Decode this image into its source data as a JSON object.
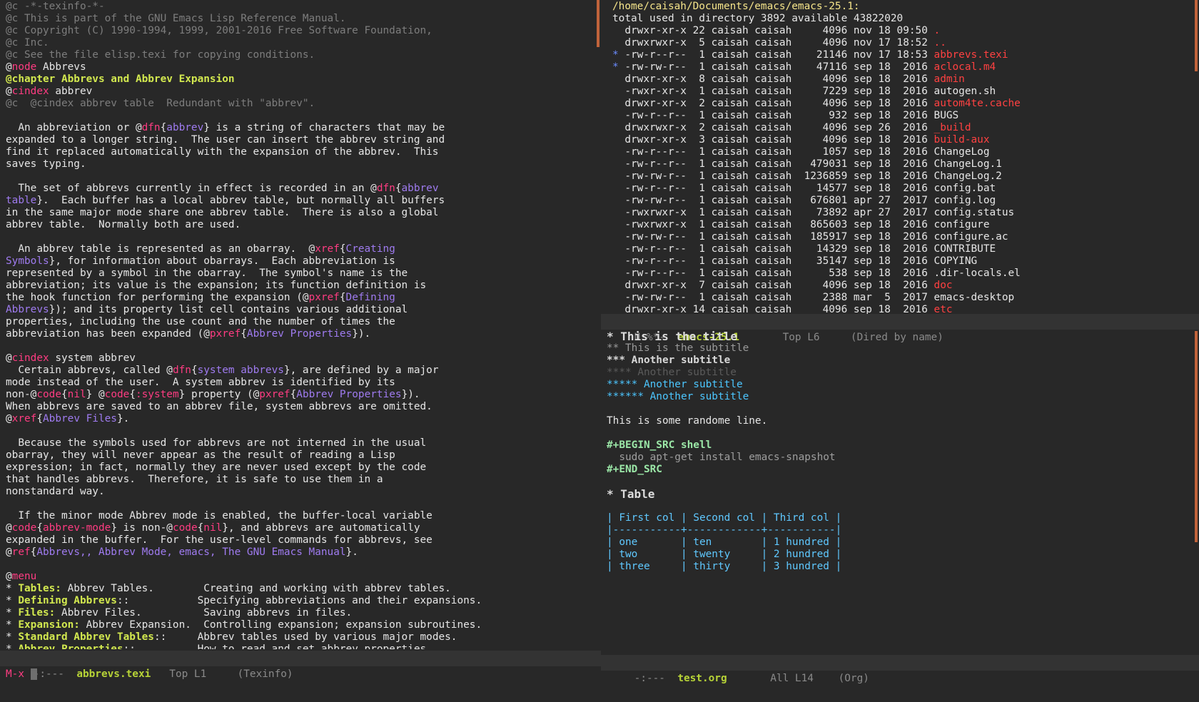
{
  "left_buffer": {
    "lines": [
      [
        [
          "@c",
          "c-com"
        ],
        [
          " -*-texinfo-*-",
          "c-com"
        ]
      ],
      [
        [
          "@c This is part of the GNU Emacs Lisp Reference Manual.",
          "c-com"
        ]
      ],
      [
        [
          "@c Copyright (C) 1990-1994, 1999, 2001-2016 Free Software Foundation,",
          "c-com"
        ]
      ],
      [
        [
          "@c Inc.",
          "c-com"
        ]
      ],
      [
        [
          "@c See the file elisp.texi for copying conditions.",
          "c-com"
        ]
      ],
      [
        [
          "@",
          ""
        ],
        [
          "node",
          "c-cmd"
        ],
        [
          " Abbrevs",
          ""
        ]
      ],
      [
        [
          "@chapter Abbrevs and Abbrev Expansion",
          "c-key"
        ]
      ],
      [
        [
          "@",
          ""
        ],
        [
          "cindex",
          "c-cmd"
        ],
        [
          " abbrev",
          ""
        ]
      ],
      [
        [
          "@c  @cindex abbrev table  Redundant with \"abbrev\".",
          "c-com"
        ]
      ],
      [
        [
          "",
          ""
        ]
      ],
      [
        [
          "  An abbreviation or @",
          ""
        ],
        [
          "dfn",
          "c-cmd"
        ],
        [
          "{",
          ""
        ],
        [
          "abbrev",
          "c-arg"
        ],
        [
          "} is a string of characters that may be",
          ""
        ]
      ],
      [
        [
          "expanded to a longer string.  The user can insert the abbrev string and",
          ""
        ]
      ],
      [
        [
          "find it replaced automatically with the expansion of the abbrev.  This",
          ""
        ]
      ],
      [
        [
          "saves typing.",
          ""
        ]
      ],
      [
        [
          "",
          ""
        ]
      ],
      [
        [
          "  The set of abbrevs currently in effect is recorded in an @",
          ""
        ],
        [
          "dfn",
          "c-cmd"
        ],
        [
          "{",
          ""
        ],
        [
          "abbrev",
          "c-arg"
        ]
      ],
      [
        [
          "table",
          "c-arg"
        ],
        [
          "}.  Each buffer has a local abbrev table, but normally all buffers",
          ""
        ]
      ],
      [
        [
          "in the same major mode share one abbrev table.  There is also a global",
          ""
        ]
      ],
      [
        [
          "abbrev table.  Normally both are used.",
          ""
        ]
      ],
      [
        [
          "",
          ""
        ]
      ],
      [
        [
          "  An abbrev table is represented as an obarray.  @",
          ""
        ],
        [
          "xref",
          "c-cmd"
        ],
        [
          "{",
          ""
        ],
        [
          "Creating",
          "c-arg"
        ]
      ],
      [
        [
          "Symbols",
          "c-arg"
        ],
        [
          "}, for information about obarrays.  Each abbreviation is",
          ""
        ]
      ],
      [
        [
          "represented by a symbol in the obarray.  The symbol's name is the",
          ""
        ]
      ],
      [
        [
          "abbreviation; its value is the expansion; its function definition is",
          ""
        ]
      ],
      [
        [
          "the hook function for performing the expansion (@",
          ""
        ],
        [
          "pxref",
          "c-cmd"
        ],
        [
          "{",
          ""
        ],
        [
          "Defining",
          "c-arg"
        ]
      ],
      [
        [
          "Abbrevs",
          "c-arg"
        ],
        [
          "}); and its property list cell contains various additional",
          ""
        ]
      ],
      [
        [
          "properties, including the use count and the number of times the",
          ""
        ]
      ],
      [
        [
          "abbreviation has been expanded (@",
          ""
        ],
        [
          "pxref",
          "c-cmd"
        ],
        [
          "{",
          ""
        ],
        [
          "Abbrev Properties",
          "c-arg"
        ],
        [
          "}).",
          ""
        ]
      ],
      [
        [
          "",
          ""
        ]
      ],
      [
        [
          "@",
          ""
        ],
        [
          "cindex",
          "c-cmd"
        ],
        [
          " system abbrev",
          ""
        ]
      ],
      [
        [
          "  Certain abbrevs, called @",
          ""
        ],
        [
          "dfn",
          "c-cmd"
        ],
        [
          "{",
          ""
        ],
        [
          "system abbrevs",
          "c-arg"
        ],
        [
          "}, are defined by a major",
          ""
        ]
      ],
      [
        [
          "mode instead of the user.  A system abbrev is identified by its",
          ""
        ]
      ],
      [
        [
          "non-@",
          ""
        ],
        [
          "code",
          "c-cmd"
        ],
        [
          "{",
          ""
        ],
        [
          "nil",
          "c-cmd"
        ],
        [
          "} @",
          ""
        ],
        [
          "code",
          "c-cmd"
        ],
        [
          "{",
          ""
        ],
        [
          ":system",
          "c-cmd"
        ],
        [
          "} property (@",
          ""
        ],
        [
          "pxref",
          "c-cmd"
        ],
        [
          "{",
          ""
        ],
        [
          "Abbrev Properties",
          "c-arg"
        ],
        [
          "}).",
          ""
        ]
      ],
      [
        [
          "When abbrevs are saved to an abbrev file, system abbrevs are omitted.",
          ""
        ]
      ],
      [
        [
          "@",
          ""
        ],
        [
          "xref",
          "c-cmd"
        ],
        [
          "{",
          ""
        ],
        [
          "Abbrev Files",
          "c-arg"
        ],
        [
          "}.",
          ""
        ]
      ],
      [
        [
          "",
          ""
        ]
      ],
      [
        [
          "  Because the symbols used for abbrevs are not interned in the usual",
          ""
        ]
      ],
      [
        [
          "obarray, they will never appear as the result of reading a Lisp",
          ""
        ]
      ],
      [
        [
          "expression; in fact, normally they are never used except by the code",
          ""
        ]
      ],
      [
        [
          "that handles abbrevs.  Therefore, it is safe to use them in a",
          ""
        ]
      ],
      [
        [
          "nonstandard way.",
          ""
        ]
      ],
      [
        [
          "",
          ""
        ]
      ],
      [
        [
          "  If the minor mode Abbrev mode is enabled, the buffer-local variable",
          ""
        ]
      ],
      [
        [
          "@",
          ""
        ],
        [
          "code",
          "c-cmd"
        ],
        [
          "{",
          ""
        ],
        [
          "abbrev-mode",
          "c-cmd"
        ],
        [
          "} is non-@",
          ""
        ],
        [
          "code",
          "c-cmd"
        ],
        [
          "{",
          ""
        ],
        [
          "nil",
          "c-cmd"
        ],
        [
          "}, and abbrevs are automatically",
          ""
        ]
      ],
      [
        [
          "expanded in the buffer.  For the user-level commands for abbrevs, see",
          ""
        ]
      ],
      [
        [
          "@",
          ""
        ],
        [
          "ref",
          "c-cmd"
        ],
        [
          "{",
          ""
        ],
        [
          "Abbrevs,, Abbrev Mode, emacs, The GNU Emacs Manual",
          "c-arg"
        ],
        [
          "}.",
          ""
        ]
      ],
      [
        [
          "",
          ""
        ]
      ],
      [
        [
          "@",
          ""
        ],
        [
          "menu",
          "c-cmd"
        ]
      ],
      [
        [
          "* ",
          ""
        ],
        [
          "Tables:",
          "c-key"
        ],
        [
          " Abbrev Tables.        Creating and working with abbrev tables.",
          ""
        ]
      ],
      [
        [
          "* ",
          ""
        ],
        [
          "Defining Abbrevs",
          "c-key"
        ],
        [
          "::           Specifying abbreviations and their expansions.",
          ""
        ]
      ],
      [
        [
          "* ",
          ""
        ],
        [
          "Files:",
          "c-key"
        ],
        [
          " Abbrev Files.          Saving abbrevs in files.",
          ""
        ]
      ],
      [
        [
          "* ",
          ""
        ],
        [
          "Expansion:",
          "c-key"
        ],
        [
          " Abbrev Expansion.  Controlling expansion; expansion subroutines.",
          ""
        ]
      ],
      [
        [
          "* ",
          ""
        ],
        [
          "Standard Abbrev Tables",
          "c-key"
        ],
        [
          "::     Abbrev tables used by various major modes.",
          ""
        ]
      ],
      [
        [
          "* ",
          ""
        ],
        [
          "Abbrev Properties",
          "c-key"
        ],
        [
          "::          How to read and set abbrev properties.",
          ""
        ]
      ]
    ],
    "modeline": {
      "status": "-:---",
      "buffer": "abbrevs.texi",
      "position": "Top L1",
      "mode": "(Texinfo)"
    }
  },
  "dired_buffer": {
    "path": "/home/caisah/Documents/emacs/emacs-25.1",
    "total": "total used in directory 3892 available 43822020",
    "rows": [
      {
        "mark": " ",
        "perms": "drwxr-xr-x",
        "links": "22",
        "owner": "caisah",
        "group": "caisah",
        "size": "4096",
        "date": "nov 18 09:50",
        "name": ".",
        "isdir": true
      },
      {
        "mark": " ",
        "perms": "drwxrwxr-x",
        "links": "5",
        "owner": "caisah",
        "group": "caisah",
        "size": "4096",
        "date": "nov 17 18:52",
        "name": "..",
        "isdir": true
      },
      {
        "mark": "*",
        "perms": "-rw-r--r--",
        "links": "1",
        "owner": "caisah",
        "group": "caisah",
        "size": "21146",
        "date": "nov 17 18:53",
        "name": "abbrevs.texi",
        "isdir": true
      },
      {
        "mark": "*",
        "perms": "-rw-rw-r--",
        "links": "1",
        "owner": "caisah",
        "group": "caisah",
        "size": "47116",
        "date": "sep 18  2016",
        "name": "aclocal.m4",
        "isdir": true
      },
      {
        "mark": " ",
        "perms": "drwxr-xr-x",
        "links": "8",
        "owner": "caisah",
        "group": "caisah",
        "size": "4096",
        "date": "sep 18  2016",
        "name": "admin",
        "isdir": true
      },
      {
        "mark": " ",
        "perms": "-rwxr-xr-x",
        "links": "1",
        "owner": "caisah",
        "group": "caisah",
        "size": "7229",
        "date": "sep 18  2016",
        "name": "autogen.sh",
        "isdir": false
      },
      {
        "mark": " ",
        "perms": "drwxr-xr-x",
        "links": "2",
        "owner": "caisah",
        "group": "caisah",
        "size": "4096",
        "date": "sep 18  2016",
        "name": "autom4te.cache",
        "isdir": true
      },
      {
        "mark": " ",
        "perms": "-rw-r--r--",
        "links": "1",
        "owner": "caisah",
        "group": "caisah",
        "size": "932",
        "date": "sep 18  2016",
        "name": "BUGS",
        "isdir": false
      },
      {
        "mark": " ",
        "perms": "drwxrwxr-x",
        "links": "2",
        "owner": "caisah",
        "group": "caisah",
        "size": "4096",
        "date": "sep 26  2016",
        "name": "_build",
        "isdir": true
      },
      {
        "mark": " ",
        "perms": "drwxr-xr-x",
        "links": "3",
        "owner": "caisah",
        "group": "caisah",
        "size": "4096",
        "date": "sep 18  2016",
        "name": "build-aux",
        "isdir": true
      },
      {
        "mark": " ",
        "perms": "-rw-r--r--",
        "links": "1",
        "owner": "caisah",
        "group": "caisah",
        "size": "1057",
        "date": "sep 18  2016",
        "name": "ChangeLog",
        "isdir": false
      },
      {
        "mark": " ",
        "perms": "-rw-r--r--",
        "links": "1",
        "owner": "caisah",
        "group": "caisah",
        "size": "479031",
        "date": "sep 18  2016",
        "name": "ChangeLog.1",
        "isdir": false
      },
      {
        "mark": " ",
        "perms": "-rw-rw-r--",
        "links": "1",
        "owner": "caisah",
        "group": "caisah",
        "size": "1236859",
        "date": "sep 18  2016",
        "name": "ChangeLog.2",
        "isdir": false
      },
      {
        "mark": " ",
        "perms": "-rw-r--r--",
        "links": "1",
        "owner": "caisah",
        "group": "caisah",
        "size": "14577",
        "date": "sep 18  2016",
        "name": "config.bat",
        "isdir": false
      },
      {
        "mark": " ",
        "perms": "-rw-rw-r--",
        "links": "1",
        "owner": "caisah",
        "group": "caisah",
        "size": "676801",
        "date": "apr 27  2017",
        "name": "config.log",
        "isdir": false
      },
      {
        "mark": " ",
        "perms": "-rwxrwxr-x",
        "links": "1",
        "owner": "caisah",
        "group": "caisah",
        "size": "73892",
        "date": "apr 27  2017",
        "name": "config.status",
        "isdir": false
      },
      {
        "mark": " ",
        "perms": "-rwxrwxr-x",
        "links": "1",
        "owner": "caisah",
        "group": "caisah",
        "size": "865603",
        "date": "sep 18  2016",
        "name": "configure",
        "isdir": false
      },
      {
        "mark": " ",
        "perms": "-rw-rw-r--",
        "links": "1",
        "owner": "caisah",
        "group": "caisah",
        "size": "185917",
        "date": "sep 18  2016",
        "name": "configure.ac",
        "isdir": false
      },
      {
        "mark": " ",
        "perms": "-rw-r--r--",
        "links": "1",
        "owner": "caisah",
        "group": "caisah",
        "size": "14329",
        "date": "sep 18  2016",
        "name": "CONTRIBUTE",
        "isdir": false
      },
      {
        "mark": " ",
        "perms": "-rw-r--r--",
        "links": "1",
        "owner": "caisah",
        "group": "caisah",
        "size": "35147",
        "date": "sep 18  2016",
        "name": "COPYING",
        "isdir": false
      },
      {
        "mark": " ",
        "perms": "-rw-r--r--",
        "links": "1",
        "owner": "caisah",
        "group": "caisah",
        "size": "538",
        "date": "sep 18  2016",
        "name": ".dir-locals.el",
        "isdir": false
      },
      {
        "mark": " ",
        "perms": "drwxr-xr-x",
        "links": "7",
        "owner": "caisah",
        "group": "caisah",
        "size": "4096",
        "date": "sep 18  2016",
        "name": "doc",
        "isdir": true
      },
      {
        "mark": " ",
        "perms": "-rw-rw-r--",
        "links": "1",
        "owner": "caisah",
        "group": "caisah",
        "size": "2388",
        "date": "mar  5  2017",
        "name": "emacs-desktop",
        "isdir": false
      },
      {
        "mark": " ",
        "perms": "drwxr-xr-x",
        "links": "14",
        "owner": "caisah",
        "group": "caisah",
        "size": "4096",
        "date": "sep 18  2016",
        "name": "etc",
        "isdir": true
      }
    ],
    "modeline": {
      "status": "U:%*-",
      "buffer": "emacs-25.1",
      "position": "Top L6",
      "mode": "(Dired by name)"
    }
  },
  "org_buffer": {
    "lines": [
      [
        [
          "* This is the title",
          "c-org1"
        ]
      ],
      [
        [
          "** This is the subtitle",
          "c-org2"
        ]
      ],
      [
        [
          "*** Another subtitle",
          "c-org3"
        ]
      ],
      [
        [
          "**** Another subtitle",
          "c-org4"
        ]
      ],
      [
        [
          "***** Another subtitle",
          "c-org5"
        ]
      ],
      [
        [
          "****** Another subtitle",
          "c-org5"
        ]
      ],
      [
        [
          "",
          ""
        ]
      ],
      [
        [
          "This is some randome line.",
          ""
        ]
      ],
      [
        [
          "",
          ""
        ]
      ],
      [
        [
          "#+BEGIN_SRC shell",
          "c-meta"
        ]
      ],
      [
        [
          "  sudo apt-get install emacs-snapshot",
          "c-src"
        ]
      ],
      [
        [
          "#+END_SRC",
          "c-meta"
        ]
      ],
      [
        [
          "",
          ""
        ]
      ],
      [
        [
          "* Table",
          "c-org1"
        ]
      ],
      [
        [
          "",
          ""
        ]
      ],
      [
        [
          "| First col | Second col | Third col |",
          "c-tbl"
        ]
      ],
      [
        [
          "|-----------+------------+-----------|",
          "c-tbl"
        ]
      ],
      [
        [
          "| one       | ten        | 1 hundred |",
          "c-tbl"
        ]
      ],
      [
        [
          "| two       | twenty     | 2 hundred |",
          "c-tbl"
        ]
      ],
      [
        [
          "| three     | thirty     | 3 hundred |",
          "c-tbl"
        ]
      ]
    ],
    "modeline": {
      "status": "-:---",
      "buffer": "test.org",
      "position": "All L14",
      "mode": "(Org)"
    }
  },
  "minibuffer": {
    "prompt": "M-x"
  }
}
